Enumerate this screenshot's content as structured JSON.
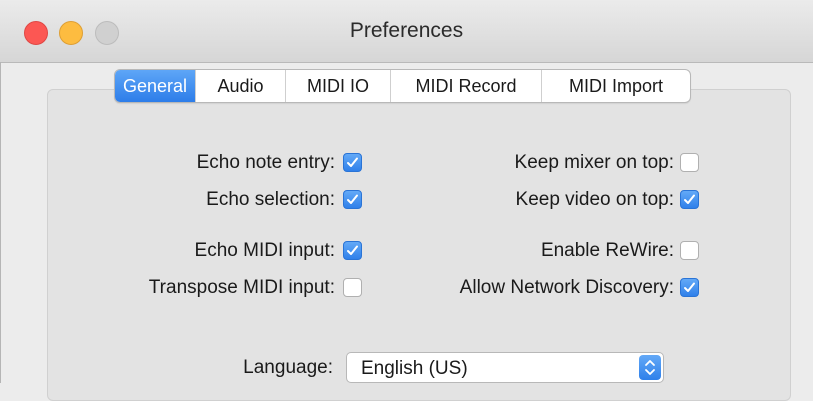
{
  "window": {
    "title": "Preferences"
  },
  "tabs": [
    {
      "label": "General",
      "selected": true
    },
    {
      "label": "Audio",
      "selected": false
    },
    {
      "label": "MIDI IO",
      "selected": false
    },
    {
      "label": "MIDI Record",
      "selected": false
    },
    {
      "label": "MIDI Import",
      "selected": false
    }
  ],
  "options": {
    "echo_note_entry": {
      "label": "Echo note entry:",
      "checked": true
    },
    "echo_selection": {
      "label": "Echo selection:",
      "checked": true
    },
    "echo_midi_input": {
      "label": "Echo MIDI input:",
      "checked": true
    },
    "transpose_midi_input": {
      "label": "Transpose MIDI input:",
      "checked": false
    },
    "keep_mixer_on_top": {
      "label": "Keep mixer on top:",
      "checked": false
    },
    "keep_video_on_top": {
      "label": "Keep video on top:",
      "checked": true
    },
    "enable_rewire": {
      "label": "Enable ReWire:",
      "checked": false
    },
    "allow_network_discovery": {
      "label": "Allow Network Discovery:",
      "checked": true
    }
  },
  "language": {
    "label": "Language:",
    "value": "English (US)"
  },
  "colors": {
    "accent": "#2f80ea",
    "close": "#fc5753",
    "minimize": "#fdbc40"
  }
}
